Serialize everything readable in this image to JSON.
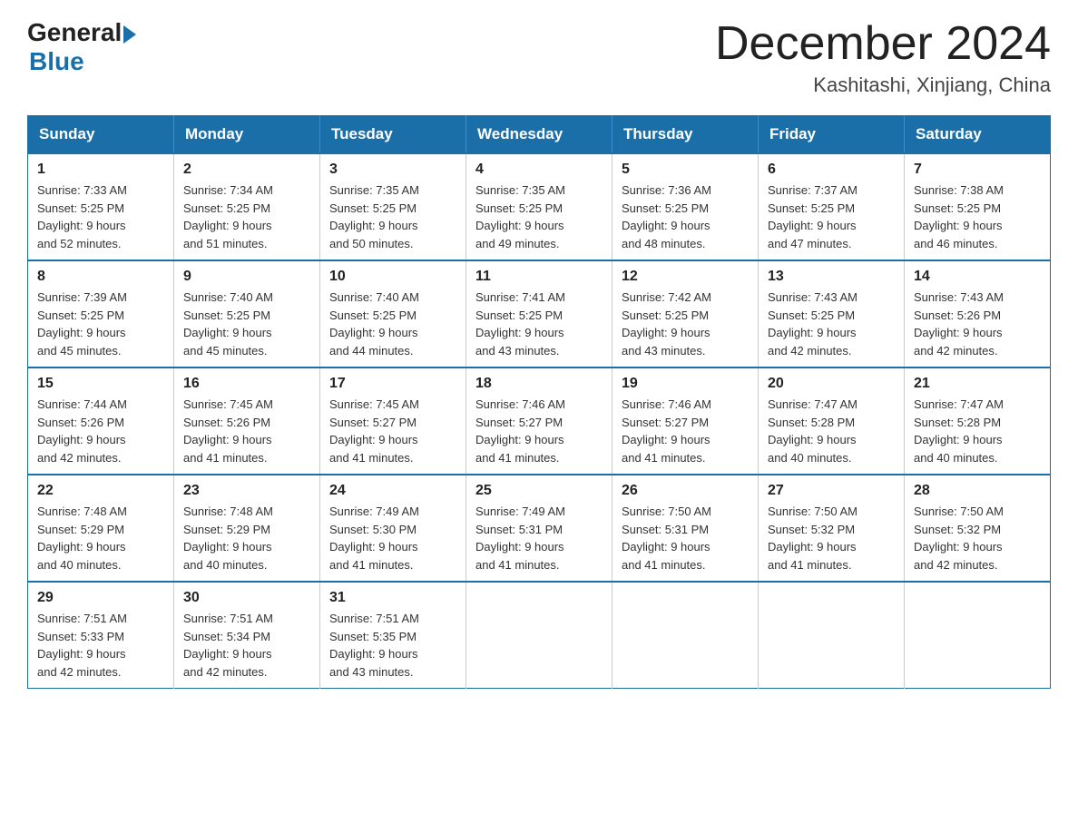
{
  "logo": {
    "general": "General",
    "blue": "Blue"
  },
  "title": "December 2024",
  "subtitle": "Kashitashi, Xinjiang, China",
  "days_of_week": [
    "Sunday",
    "Monday",
    "Tuesday",
    "Wednesday",
    "Thursday",
    "Friday",
    "Saturday"
  ],
  "weeks": [
    [
      {
        "day": "1",
        "sunrise": "7:33 AM",
        "sunset": "5:25 PM",
        "daylight": "9 hours and 52 minutes."
      },
      {
        "day": "2",
        "sunrise": "7:34 AM",
        "sunset": "5:25 PM",
        "daylight": "9 hours and 51 minutes."
      },
      {
        "day": "3",
        "sunrise": "7:35 AM",
        "sunset": "5:25 PM",
        "daylight": "9 hours and 50 minutes."
      },
      {
        "day": "4",
        "sunrise": "7:35 AM",
        "sunset": "5:25 PM",
        "daylight": "9 hours and 49 minutes."
      },
      {
        "day": "5",
        "sunrise": "7:36 AM",
        "sunset": "5:25 PM",
        "daylight": "9 hours and 48 minutes."
      },
      {
        "day": "6",
        "sunrise": "7:37 AM",
        "sunset": "5:25 PM",
        "daylight": "9 hours and 47 minutes."
      },
      {
        "day": "7",
        "sunrise": "7:38 AM",
        "sunset": "5:25 PM",
        "daylight": "9 hours and 46 minutes."
      }
    ],
    [
      {
        "day": "8",
        "sunrise": "7:39 AM",
        "sunset": "5:25 PM",
        "daylight": "9 hours and 45 minutes."
      },
      {
        "day": "9",
        "sunrise": "7:40 AM",
        "sunset": "5:25 PM",
        "daylight": "9 hours and 45 minutes."
      },
      {
        "day": "10",
        "sunrise": "7:40 AM",
        "sunset": "5:25 PM",
        "daylight": "9 hours and 44 minutes."
      },
      {
        "day": "11",
        "sunrise": "7:41 AM",
        "sunset": "5:25 PM",
        "daylight": "9 hours and 43 minutes."
      },
      {
        "day": "12",
        "sunrise": "7:42 AM",
        "sunset": "5:25 PM",
        "daylight": "9 hours and 43 minutes."
      },
      {
        "day": "13",
        "sunrise": "7:43 AM",
        "sunset": "5:25 PM",
        "daylight": "9 hours and 42 minutes."
      },
      {
        "day": "14",
        "sunrise": "7:43 AM",
        "sunset": "5:26 PM",
        "daylight": "9 hours and 42 minutes."
      }
    ],
    [
      {
        "day": "15",
        "sunrise": "7:44 AM",
        "sunset": "5:26 PM",
        "daylight": "9 hours and 42 minutes."
      },
      {
        "day": "16",
        "sunrise": "7:45 AM",
        "sunset": "5:26 PM",
        "daylight": "9 hours and 41 minutes."
      },
      {
        "day": "17",
        "sunrise": "7:45 AM",
        "sunset": "5:27 PM",
        "daylight": "9 hours and 41 minutes."
      },
      {
        "day": "18",
        "sunrise": "7:46 AM",
        "sunset": "5:27 PM",
        "daylight": "9 hours and 41 minutes."
      },
      {
        "day": "19",
        "sunrise": "7:46 AM",
        "sunset": "5:27 PM",
        "daylight": "9 hours and 41 minutes."
      },
      {
        "day": "20",
        "sunrise": "7:47 AM",
        "sunset": "5:28 PM",
        "daylight": "9 hours and 40 minutes."
      },
      {
        "day": "21",
        "sunrise": "7:47 AM",
        "sunset": "5:28 PM",
        "daylight": "9 hours and 40 minutes."
      }
    ],
    [
      {
        "day": "22",
        "sunrise": "7:48 AM",
        "sunset": "5:29 PM",
        "daylight": "9 hours and 40 minutes."
      },
      {
        "day": "23",
        "sunrise": "7:48 AM",
        "sunset": "5:29 PM",
        "daylight": "9 hours and 40 minutes."
      },
      {
        "day": "24",
        "sunrise": "7:49 AM",
        "sunset": "5:30 PM",
        "daylight": "9 hours and 41 minutes."
      },
      {
        "day": "25",
        "sunrise": "7:49 AM",
        "sunset": "5:31 PM",
        "daylight": "9 hours and 41 minutes."
      },
      {
        "day": "26",
        "sunrise": "7:50 AM",
        "sunset": "5:31 PM",
        "daylight": "9 hours and 41 minutes."
      },
      {
        "day": "27",
        "sunrise": "7:50 AM",
        "sunset": "5:32 PM",
        "daylight": "9 hours and 41 minutes."
      },
      {
        "day": "28",
        "sunrise": "7:50 AM",
        "sunset": "5:32 PM",
        "daylight": "9 hours and 42 minutes."
      }
    ],
    [
      {
        "day": "29",
        "sunrise": "7:51 AM",
        "sunset": "5:33 PM",
        "daylight": "9 hours and 42 minutes."
      },
      {
        "day": "30",
        "sunrise": "7:51 AM",
        "sunset": "5:34 PM",
        "daylight": "9 hours and 42 minutes."
      },
      {
        "day": "31",
        "sunrise": "7:51 AM",
        "sunset": "5:35 PM",
        "daylight": "9 hours and 43 minutes."
      },
      null,
      null,
      null,
      null
    ]
  ],
  "labels": {
    "sunrise": "Sunrise:",
    "sunset": "Sunset:",
    "daylight": "Daylight:"
  }
}
